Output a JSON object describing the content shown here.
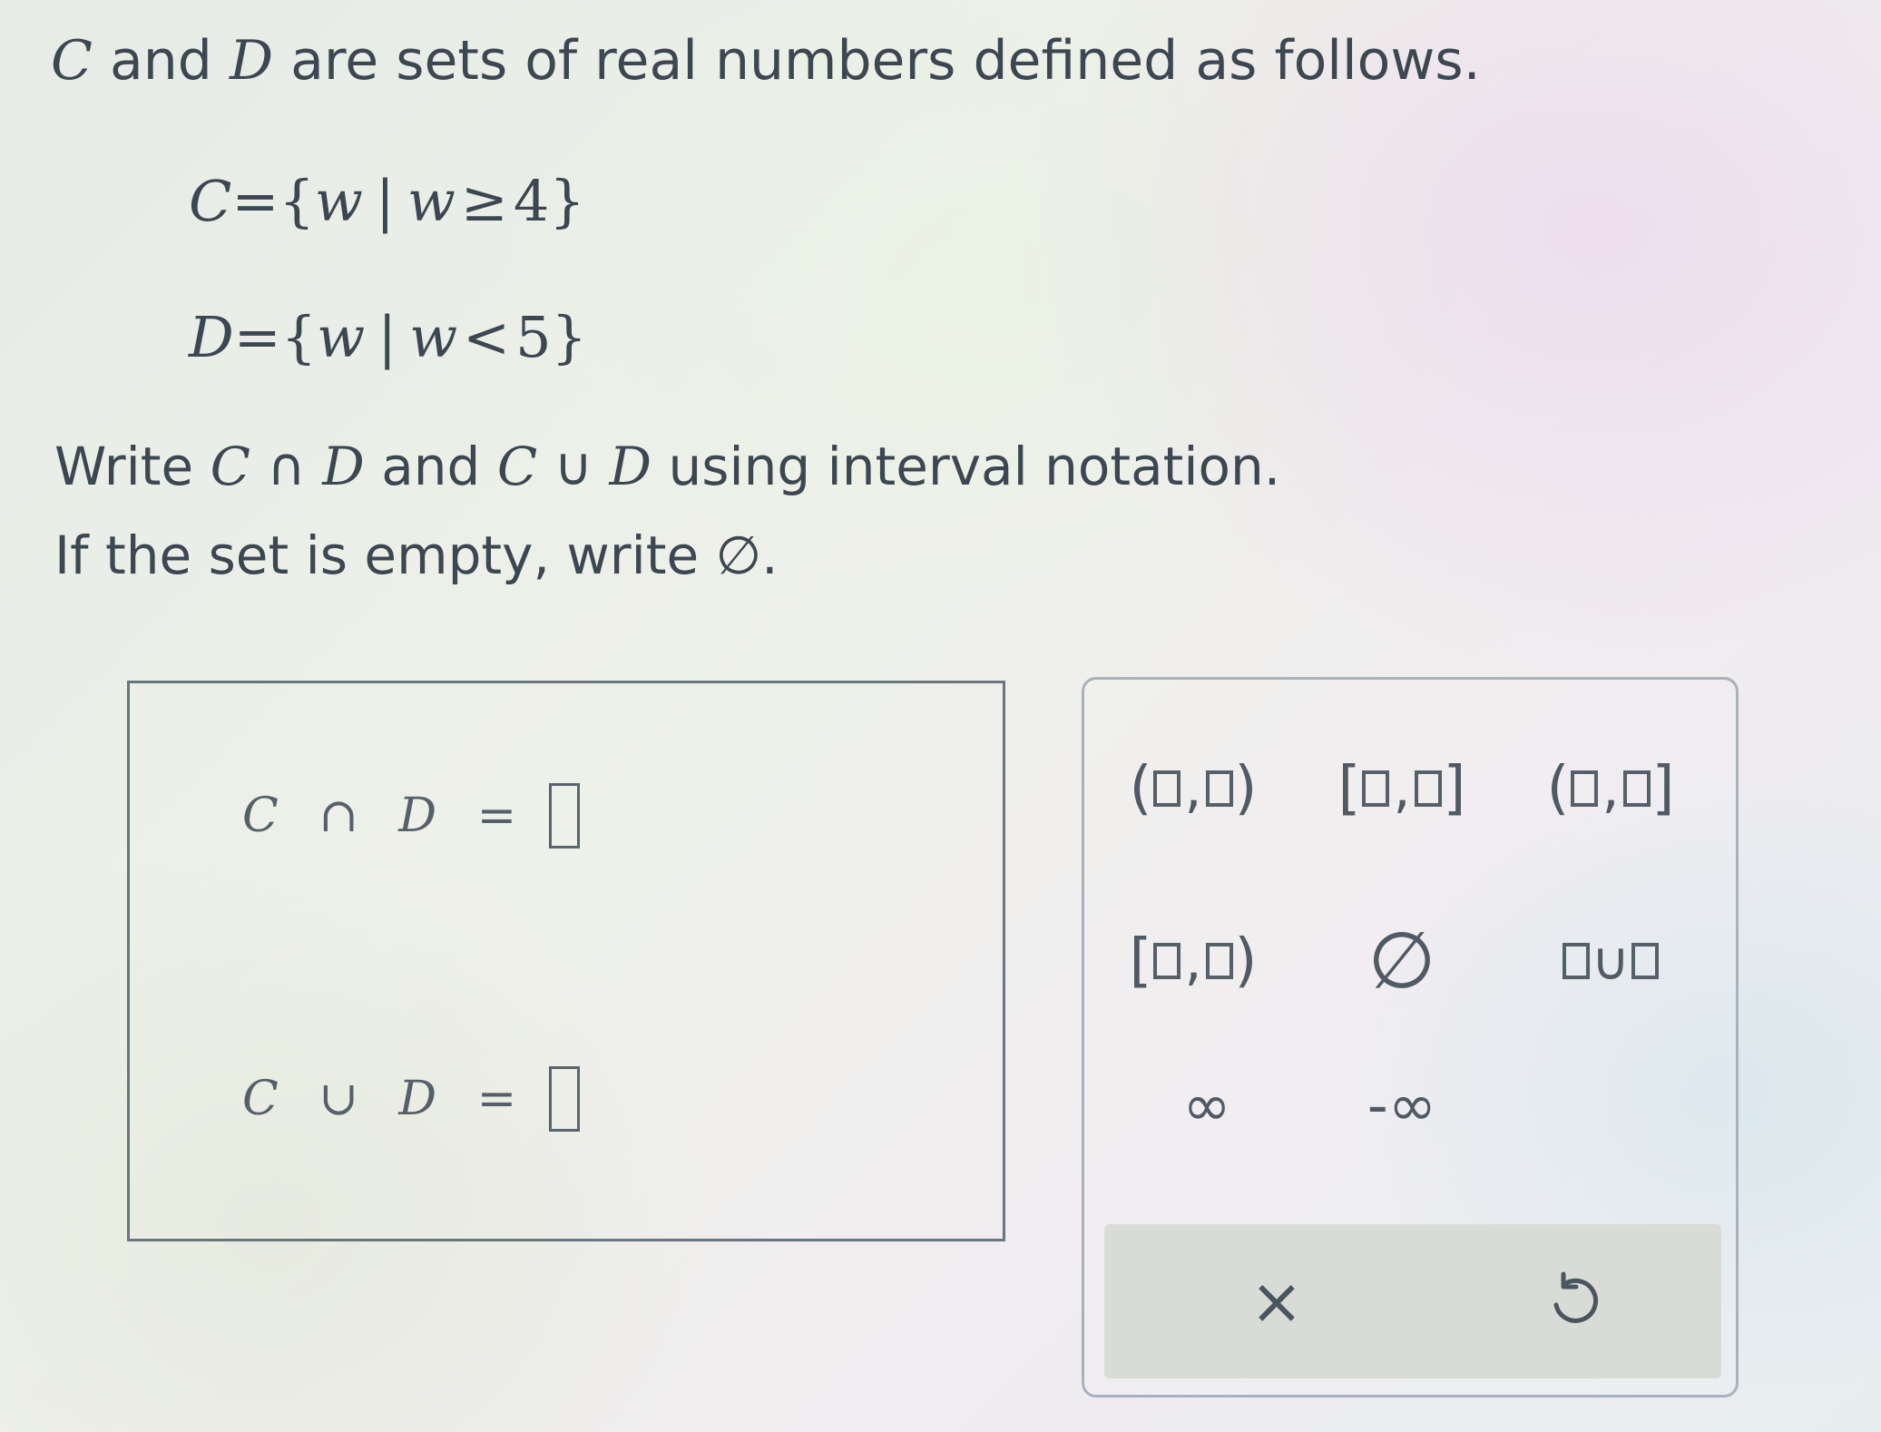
{
  "problem": {
    "intro": {
      "set_c": "C",
      "and": " and ",
      "set_d": "D",
      "rest": " are sets of real numbers defined as follows."
    },
    "def_c": {
      "name": "C",
      "eq": "=",
      "open": "{",
      "var": "w",
      "bar": "|",
      "var2": "w",
      "rel": "≥",
      "num": "4",
      "close": "}"
    },
    "def_d": {
      "name": "D",
      "eq": "=",
      "open": "{",
      "var": "w",
      "bar": "|",
      "var2": "w",
      "rel": "<",
      "num": "5",
      "close": "}"
    },
    "instruction1": {
      "write": "Write ",
      "c1": "C",
      "cap": " ∩ ",
      "d1": "D",
      "and": " and ",
      "c2": "C",
      "cup": " ∪ ",
      "d2": "D",
      "rest": " using interval notation."
    },
    "instruction2": {
      "text": "If the set is empty, write ",
      "symbol": "∅",
      "end": "."
    }
  },
  "answers": {
    "intersection_label": "C ∩ D =",
    "union_label": "C ∪ D =",
    "intersection_value": "",
    "union_value": ""
  },
  "keypad": {
    "open_open": {
      "left": "(",
      "comma": ",",
      "right": ")"
    },
    "closed_closed": {
      "left": "[",
      "comma": ",",
      "right": "]"
    },
    "open_closed": {
      "left": "(",
      "comma": ",",
      "right": "]"
    },
    "closed_open": {
      "left": "[",
      "comma": ",",
      "right": ")"
    },
    "empty_set": "∅",
    "union_symbol": "∪",
    "infinity": "∞",
    "neg_infinity": "-∞",
    "clear_icon": "×"
  }
}
